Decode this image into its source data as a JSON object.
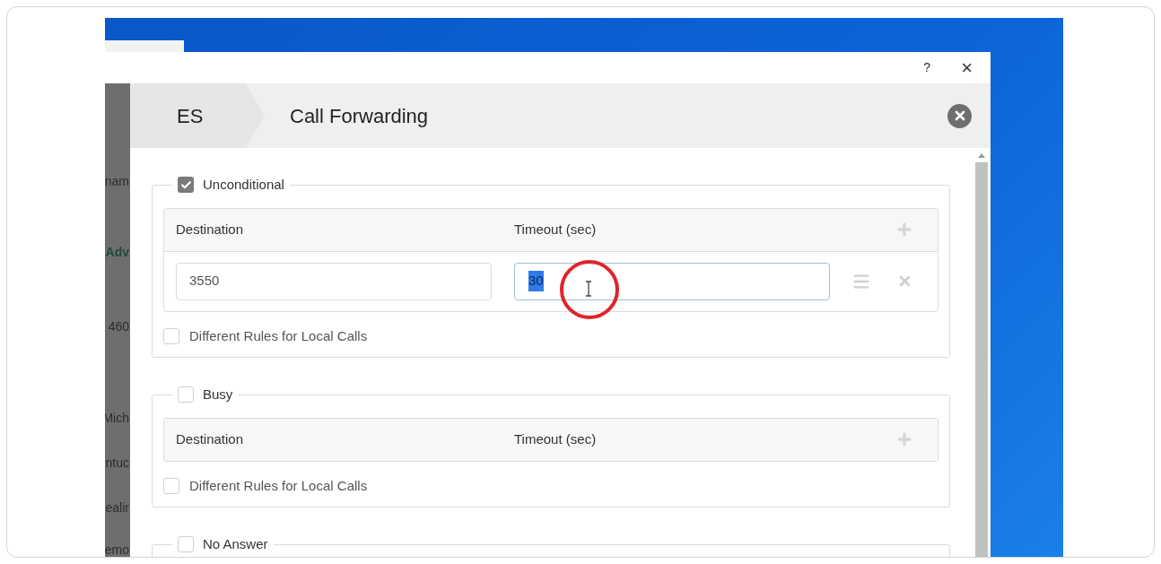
{
  "background_app": {
    "fragments": [
      "nam",
      "Adv",
      "460",
      "Mich",
      "ntuc",
      "ealir",
      "emo"
    ]
  },
  "dialog": {
    "help": "?",
    "close": "×"
  },
  "header": {
    "breadcrumb": [
      "ES",
      "Call Forwarding"
    ]
  },
  "sections": [
    {
      "title": "Unconditional",
      "checked": true,
      "columns": [
        "Destination",
        "Timeout (sec)"
      ],
      "rows": [
        {
          "destination": "3550",
          "timeout": "30",
          "timeout_selected": true
        }
      ],
      "local_rules": {
        "label": "Different Rules for Local Calls",
        "checked": false
      }
    },
    {
      "title": "Busy",
      "checked": false,
      "columns": [
        "Destination",
        "Timeout (sec)"
      ],
      "local_rules": {
        "label": "Different Rules for Local Calls",
        "checked": false
      }
    },
    {
      "title": "No Answer",
      "checked": false
    }
  ]
}
